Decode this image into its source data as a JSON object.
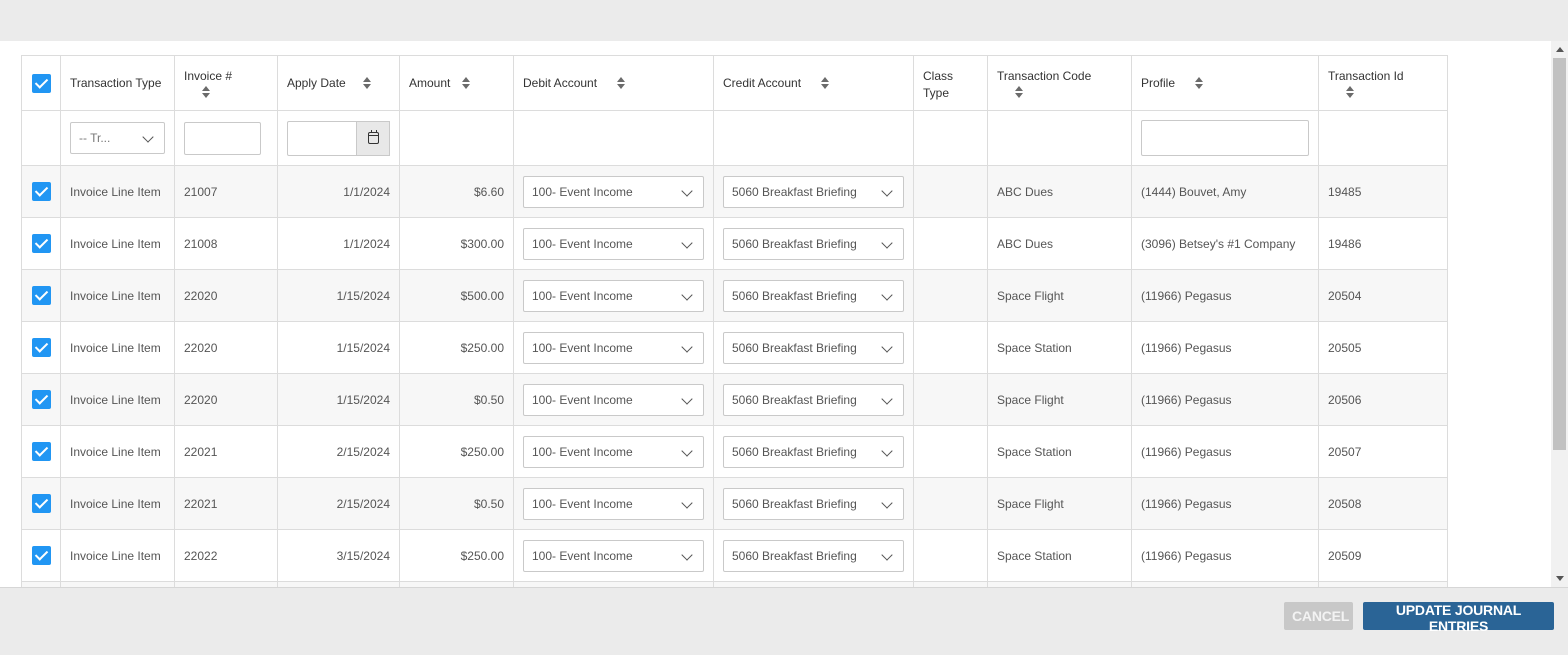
{
  "columns": {
    "transaction_type": "Transaction Type",
    "invoice": "Invoice #",
    "apply_date": "Apply Date",
    "amount": "Amount",
    "debit_account": "Debit Account",
    "credit_account": "Credit Account",
    "class_type": "Class Type",
    "transaction_code": "Transaction Code",
    "profile": "Profile",
    "transaction_id": "Transaction Id"
  },
  "filters": {
    "transaction_type_selected": "-- Tr...",
    "invoice_value": "",
    "apply_date_value": "",
    "profile_value": ""
  },
  "rows": [
    {
      "type": "Invoice Line Item",
      "invoice": "21007",
      "date": "1/1/2024",
      "amount": "$6.60",
      "debit": "100- Event Income",
      "credit": "5060 Breakfast Briefing",
      "class_type": "",
      "code": "ABC Dues",
      "profile": "(1444) Bouvet, Amy",
      "id": "19485",
      "checked": true
    },
    {
      "type": "Invoice Line Item",
      "invoice": "21008",
      "date": "1/1/2024",
      "amount": "$300.00",
      "debit": "100- Event Income",
      "credit": "5060 Breakfast Briefing",
      "class_type": "",
      "code": "ABC Dues",
      "profile": "(3096) Betsey's #1 Company",
      "id": "19486",
      "checked": true
    },
    {
      "type": "Invoice Line Item",
      "invoice": "22020",
      "date": "1/15/2024",
      "amount": "$500.00",
      "debit": "100- Event Income",
      "credit": "5060 Breakfast Briefing",
      "class_type": "",
      "code": "Space Flight",
      "profile": "(11966) Pegasus",
      "id": "20504",
      "checked": true
    },
    {
      "type": "Invoice Line Item",
      "invoice": "22020",
      "date": "1/15/2024",
      "amount": "$250.00",
      "debit": "100- Event Income",
      "credit": "5060 Breakfast Briefing",
      "class_type": "",
      "code": "Space Station",
      "profile": "(11966) Pegasus",
      "id": "20505",
      "checked": true
    },
    {
      "type": "Invoice Line Item",
      "invoice": "22020",
      "date": "1/15/2024",
      "amount": "$0.50",
      "debit": "100- Event Income",
      "credit": "5060 Breakfast Briefing",
      "class_type": "",
      "code": "Space Flight",
      "profile": "(11966) Pegasus",
      "id": "20506",
      "checked": true
    },
    {
      "type": "Invoice Line Item",
      "invoice": "22021",
      "date": "2/15/2024",
      "amount": "$250.00",
      "debit": "100- Event Income",
      "credit": "5060 Breakfast Briefing",
      "class_type": "",
      "code": "Space Station",
      "profile": "(11966) Pegasus",
      "id": "20507",
      "checked": true
    },
    {
      "type": "Invoice Line Item",
      "invoice": "22021",
      "date": "2/15/2024",
      "amount": "$0.50",
      "debit": "100- Event Income",
      "credit": "5060 Breakfast Briefing",
      "class_type": "",
      "code": "Space Flight",
      "profile": "(11966) Pegasus",
      "id": "20508",
      "checked": true
    },
    {
      "type": "Invoice Line Item",
      "invoice": "22022",
      "date": "3/15/2024",
      "amount": "$250.00",
      "debit": "100- Event Income",
      "credit": "5060 Breakfast Briefing",
      "class_type": "",
      "code": "Space Station",
      "profile": "(11966) Pegasus",
      "id": "20509",
      "checked": true
    }
  ],
  "footer": {
    "cancel_label": "CANCEL",
    "update_label": "UPDATE JOURNAL ENTRIES"
  },
  "colors": {
    "checkbox": "#2196f3",
    "update_button": "#2a6496",
    "cancel_button": "#c8c8c8"
  }
}
